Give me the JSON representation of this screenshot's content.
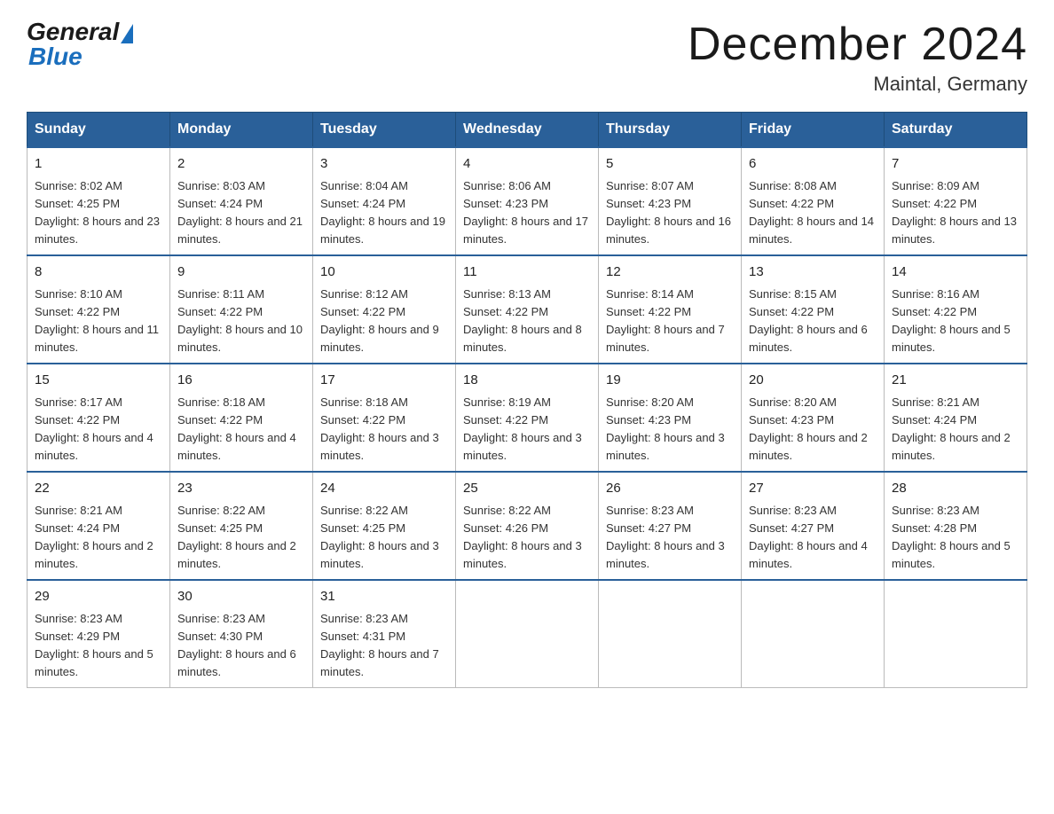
{
  "header": {
    "logo_general": "General",
    "logo_blue": "Blue",
    "month_title": "December 2024",
    "location": "Maintal, Germany"
  },
  "weekdays": [
    "Sunday",
    "Monday",
    "Tuesday",
    "Wednesday",
    "Thursday",
    "Friday",
    "Saturday"
  ],
  "weeks": [
    [
      {
        "day": "1",
        "sunrise": "8:02 AM",
        "sunset": "4:25 PM",
        "daylight": "8 hours and 23 minutes."
      },
      {
        "day": "2",
        "sunrise": "8:03 AM",
        "sunset": "4:24 PM",
        "daylight": "8 hours and 21 minutes."
      },
      {
        "day": "3",
        "sunrise": "8:04 AM",
        "sunset": "4:24 PM",
        "daylight": "8 hours and 19 minutes."
      },
      {
        "day": "4",
        "sunrise": "8:06 AM",
        "sunset": "4:23 PM",
        "daylight": "8 hours and 17 minutes."
      },
      {
        "day": "5",
        "sunrise": "8:07 AM",
        "sunset": "4:23 PM",
        "daylight": "8 hours and 16 minutes."
      },
      {
        "day": "6",
        "sunrise": "8:08 AM",
        "sunset": "4:22 PM",
        "daylight": "8 hours and 14 minutes."
      },
      {
        "day": "7",
        "sunrise": "8:09 AM",
        "sunset": "4:22 PM",
        "daylight": "8 hours and 13 minutes."
      }
    ],
    [
      {
        "day": "8",
        "sunrise": "8:10 AM",
        "sunset": "4:22 PM",
        "daylight": "8 hours and 11 minutes."
      },
      {
        "day": "9",
        "sunrise": "8:11 AM",
        "sunset": "4:22 PM",
        "daylight": "8 hours and 10 minutes."
      },
      {
        "day": "10",
        "sunrise": "8:12 AM",
        "sunset": "4:22 PM",
        "daylight": "8 hours and 9 minutes."
      },
      {
        "day": "11",
        "sunrise": "8:13 AM",
        "sunset": "4:22 PM",
        "daylight": "8 hours and 8 minutes."
      },
      {
        "day": "12",
        "sunrise": "8:14 AM",
        "sunset": "4:22 PM",
        "daylight": "8 hours and 7 minutes."
      },
      {
        "day": "13",
        "sunrise": "8:15 AM",
        "sunset": "4:22 PM",
        "daylight": "8 hours and 6 minutes."
      },
      {
        "day": "14",
        "sunrise": "8:16 AM",
        "sunset": "4:22 PM",
        "daylight": "8 hours and 5 minutes."
      }
    ],
    [
      {
        "day": "15",
        "sunrise": "8:17 AM",
        "sunset": "4:22 PM",
        "daylight": "8 hours and 4 minutes."
      },
      {
        "day": "16",
        "sunrise": "8:18 AM",
        "sunset": "4:22 PM",
        "daylight": "8 hours and 4 minutes."
      },
      {
        "day": "17",
        "sunrise": "8:18 AM",
        "sunset": "4:22 PM",
        "daylight": "8 hours and 3 minutes."
      },
      {
        "day": "18",
        "sunrise": "8:19 AM",
        "sunset": "4:22 PM",
        "daylight": "8 hours and 3 minutes."
      },
      {
        "day": "19",
        "sunrise": "8:20 AM",
        "sunset": "4:23 PM",
        "daylight": "8 hours and 3 minutes."
      },
      {
        "day": "20",
        "sunrise": "8:20 AM",
        "sunset": "4:23 PM",
        "daylight": "8 hours and 2 minutes."
      },
      {
        "day": "21",
        "sunrise": "8:21 AM",
        "sunset": "4:24 PM",
        "daylight": "8 hours and 2 minutes."
      }
    ],
    [
      {
        "day": "22",
        "sunrise": "8:21 AM",
        "sunset": "4:24 PM",
        "daylight": "8 hours and 2 minutes."
      },
      {
        "day": "23",
        "sunrise": "8:22 AM",
        "sunset": "4:25 PM",
        "daylight": "8 hours and 2 minutes."
      },
      {
        "day": "24",
        "sunrise": "8:22 AM",
        "sunset": "4:25 PM",
        "daylight": "8 hours and 3 minutes."
      },
      {
        "day": "25",
        "sunrise": "8:22 AM",
        "sunset": "4:26 PM",
        "daylight": "8 hours and 3 minutes."
      },
      {
        "day": "26",
        "sunrise": "8:23 AM",
        "sunset": "4:27 PM",
        "daylight": "8 hours and 3 minutes."
      },
      {
        "day": "27",
        "sunrise": "8:23 AM",
        "sunset": "4:27 PM",
        "daylight": "8 hours and 4 minutes."
      },
      {
        "day": "28",
        "sunrise": "8:23 AM",
        "sunset": "4:28 PM",
        "daylight": "8 hours and 5 minutes."
      }
    ],
    [
      {
        "day": "29",
        "sunrise": "8:23 AM",
        "sunset": "4:29 PM",
        "daylight": "8 hours and 5 minutes."
      },
      {
        "day": "30",
        "sunrise": "8:23 AM",
        "sunset": "4:30 PM",
        "daylight": "8 hours and 6 minutes."
      },
      {
        "day": "31",
        "sunrise": "8:23 AM",
        "sunset": "4:31 PM",
        "daylight": "8 hours and 7 minutes."
      },
      null,
      null,
      null,
      null
    ]
  ]
}
